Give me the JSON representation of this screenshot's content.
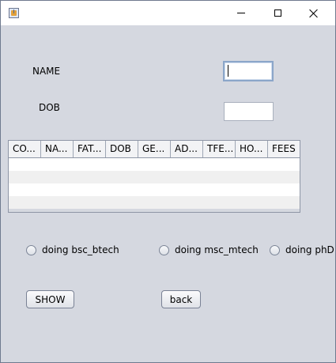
{
  "form": {
    "name_label": "NAME",
    "name_value": "",
    "dob_label": "DOB",
    "dob_value": ""
  },
  "table": {
    "columns": [
      "CO...",
      "NA...",
      "FAT...",
      "DOB",
      "GE...",
      "AD...",
      "TFE...",
      "HO...",
      "FEES"
    ],
    "rows": []
  },
  "radios": [
    {
      "label": "doing bsc_btech",
      "selected": false
    },
    {
      "label": "doing msc_mtech",
      "selected": false
    },
    {
      "label": "doing phD",
      "selected": false
    }
  ],
  "buttons": {
    "show_label": "SHOW",
    "back_label": "back"
  },
  "icons": {
    "app": "java-app-icon",
    "minimize": "minimize-icon",
    "maximize": "maximize-icon",
    "close": "close-icon"
  }
}
